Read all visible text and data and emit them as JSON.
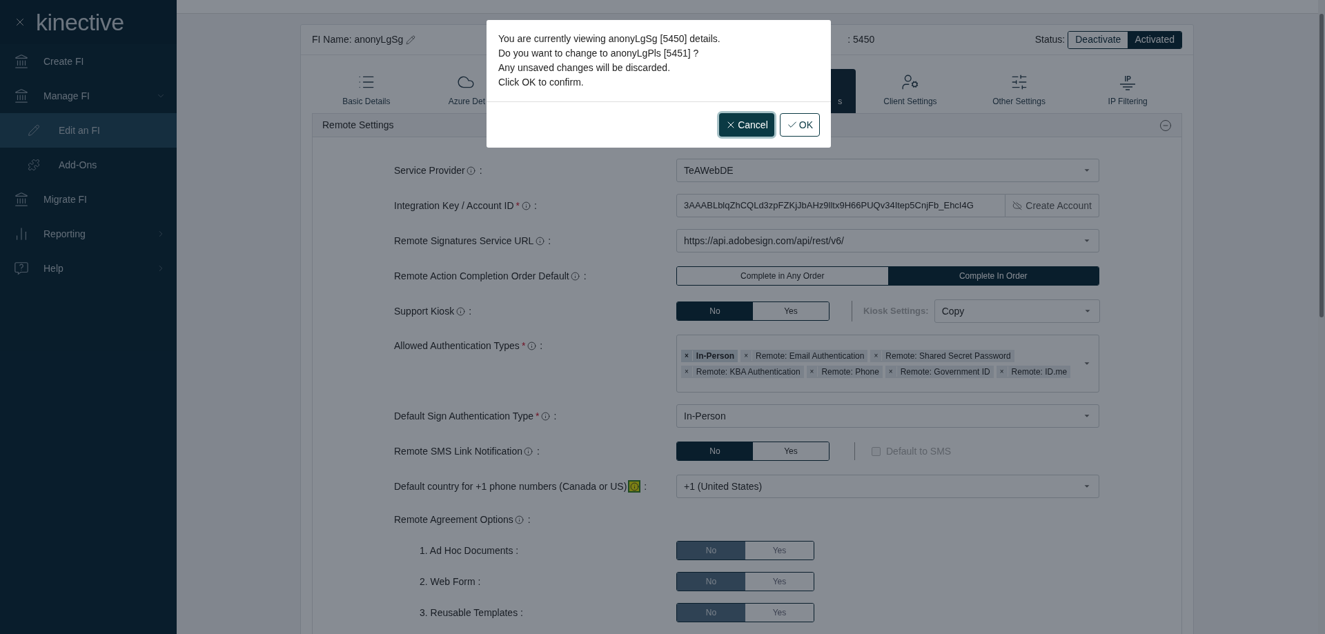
{
  "sidebar": {
    "logo": "kinective",
    "items": [
      {
        "label": "Create FI",
        "kind": "create",
        "selected": false
      },
      {
        "label": "Manage FI",
        "kind": "manage",
        "selected": false,
        "expanded": true,
        "children": [
          {
            "label": "Edit an FI",
            "kind": "edit",
            "selected": true
          },
          {
            "label": "Add-Ons",
            "kind": "addon",
            "selected": false
          }
        ]
      },
      {
        "label": "Migrate FI",
        "kind": "migrate",
        "selected": false
      },
      {
        "label": "Reporting",
        "kind": "report",
        "selected": false,
        "expanded": false
      },
      {
        "label": "Help",
        "kind": "help",
        "selected": false,
        "expanded": false
      }
    ]
  },
  "header": {
    "fi_name": "FI Name: anonyLgSg",
    "fi_id": ": 5450",
    "status_label": "Status:",
    "status_options": [
      {
        "label": "Deactivate",
        "selected": false
      },
      {
        "label": "Activated",
        "selected": true
      }
    ]
  },
  "tabs": [
    {
      "label": "Basic Details",
      "kind": "list",
      "selected": false
    },
    {
      "label": "Azure Det",
      "kind": "cloud",
      "selected": false
    },
    {
      "label": "s",
      "kind": "covered",
      "selected": true
    },
    {
      "label": "Client Settings",
      "kind": "user",
      "selected": false
    },
    {
      "label": "Other Settings",
      "kind": "sliders",
      "selected": false
    },
    {
      "label": "IP Filtering",
      "kind": "ip",
      "icon_text": "IP",
      "selected": false
    }
  ],
  "section": {
    "title": "Remote Settings",
    "expanded": true,
    "fields": [
      {
        "kind": "select",
        "label": "Service Provider",
        "suffix": ":",
        "value": "TeAWebDE"
      },
      {
        "kind": "input",
        "label": "Integration Key / Account ID",
        "required_mark": "*",
        "suffix": ":",
        "value": "3AAABLblqZhCQLd3zpFZKjJbAHz9lltx9H66PUQv34Itep5CnjFb_EhcI4G",
        "button": "Create Account"
      },
      {
        "kind": "select",
        "label": "Remote Signatures Service URL",
        "suffix": ":",
        "value": "https://api.adobesign.com/api/rest/v6/"
      },
      {
        "kind": "toggle",
        "label": "Remote Action Completion Order Default",
        "suffix": ":",
        "wide": true,
        "disabled": false,
        "options": [
          {
            "label": "Complete in Any Order",
            "selected": false
          },
          {
            "label": "Complete In Order",
            "selected": true
          }
        ]
      },
      {
        "kind": "toggle",
        "label": "Support Kiosk",
        "suffix": ":",
        "disabled": false,
        "options": [
          {
            "label": "No",
            "selected": true
          },
          {
            "label": "Yes",
            "selected": false
          }
        ],
        "extra": {
          "kind": "select",
          "label": "Kiosk Settings:",
          "value": "Copy"
        }
      },
      {
        "kind": "tags",
        "label": "Allowed Authentication Types",
        "required_mark": "*",
        "suffix": ":",
        "tags": [
          {
            "remove": "×",
            "label": "In-Person",
            "selected": true
          },
          {
            "remove": "×",
            "label": "Remote: Email Authentication",
            "selected": false
          },
          {
            "remove": "×",
            "label": "Remote: Shared Secret Password",
            "selected": false
          },
          {
            "remove": "×",
            "label": "Remote: KBA Authentication",
            "selected": false
          },
          {
            "remove": "×",
            "label": "Remote: Phone",
            "selected": false
          },
          {
            "remove": "×",
            "label": "Remote: Government ID",
            "selected": false
          },
          {
            "remove": "×",
            "label": "Remote: ID.me",
            "selected": false
          }
        ]
      },
      {
        "kind": "select",
        "label": "Default Sign Authentication Type",
        "required_mark": "*",
        "suffix": ":",
        "value": "In-Person"
      },
      {
        "kind": "toggle",
        "label": "Remote SMS Link Notification",
        "suffix": ":",
        "disabled": false,
        "options": [
          {
            "label": "No",
            "selected": true
          },
          {
            "label": "Yes",
            "selected": false
          }
        ],
        "extra": {
          "kind": "checkbox",
          "label": "Default to SMS",
          "checked": false,
          "disabled": true
        }
      },
      {
        "kind": "select",
        "label": "Default country for +1 phone numbers (Canada or US)",
        "suffix": ":",
        "info_highlighted": true,
        "value": "+1 (United States)"
      },
      {
        "kind": "heading",
        "label": "Remote Agreement Options",
        "suffix": ":"
      },
      {
        "kind": "subtoggle",
        "label": "1. Ad Hoc Documents :",
        "disabled": true,
        "options": [
          {
            "label": "No",
            "selected": true
          },
          {
            "label": "Yes",
            "selected": false
          }
        ]
      },
      {
        "kind": "subtoggle",
        "label": "2. Web Form :",
        "disabled": true,
        "options": [
          {
            "label": "No",
            "selected": true
          },
          {
            "label": "Yes",
            "selected": false
          }
        ]
      },
      {
        "kind": "subtoggle",
        "label": "3. Reusable Templates :",
        "disabled": true,
        "options": [
          {
            "label": "No",
            "selected": true
          },
          {
            "label": "Yes",
            "selected": false
          }
        ]
      }
    ]
  },
  "dialog": {
    "lines": [
      "You are currently viewing anonyLgSg [5450] details.",
      "Do you want to change to anonyLgPls [5451] ?",
      "Any unsaved changes will be discarded.",
      "Click OK to confirm."
    ],
    "buttons": [
      {
        "label": "Cancel",
        "kind": "cancel",
        "focused": true
      },
      {
        "label": "OK",
        "kind": "ok",
        "focused": false
      }
    ]
  }
}
